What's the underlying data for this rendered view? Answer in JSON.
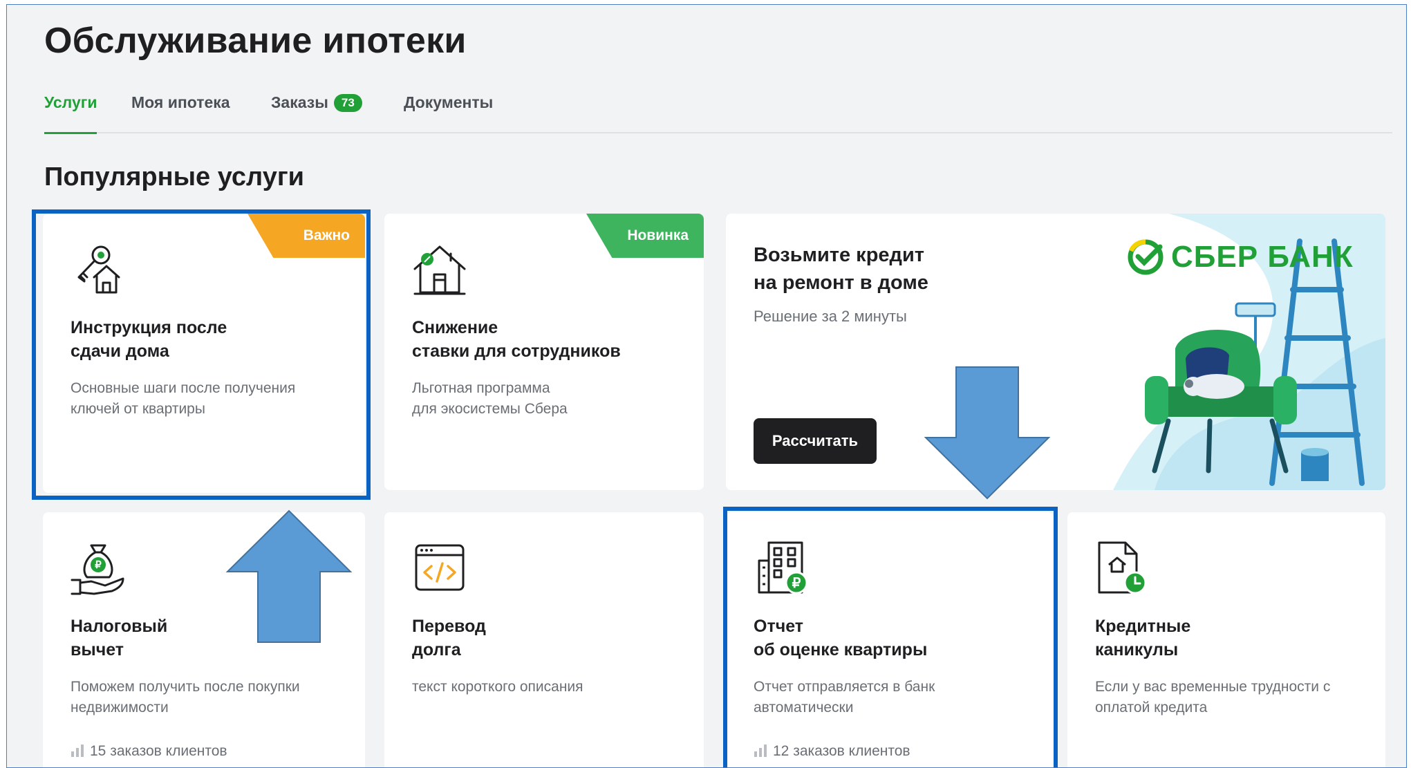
{
  "page": {
    "title": "Обслуживание ипотеки"
  },
  "tabs": [
    {
      "label": "Услуги",
      "active": true
    },
    {
      "label": "Моя ипотека"
    },
    {
      "label": "Заказы",
      "badge": "73"
    },
    {
      "label": "Документы"
    }
  ],
  "section": {
    "title": "Популярные услуги"
  },
  "cards": {
    "instruction": {
      "ribbon": "Важно",
      "title_line1": "Инструкция после",
      "title_line2": "сдачи дома",
      "desc_line1": "Основные шаги после получения",
      "desc_line2": "ключей от квартиры",
      "icon": "keys-house-icon"
    },
    "rate": {
      "ribbon": "Новинка",
      "title_line1": "Снижение",
      "title_line2": "ставки для сотрудников",
      "desc_line1": "Льготная программа",
      "desc_line2": "для экосистемы Сбера",
      "icon": "house-percent-icon"
    },
    "promo": {
      "title_line1": "Возьмите кредит",
      "title_line2": "на ремонт в доме",
      "subtitle": "Решение за 2 минуты",
      "button": "Рассчитать",
      "brand": "СБЕР БАНК"
    },
    "tax": {
      "title_line1": "Налоговый",
      "title_line2": "вычет",
      "desc_line1": "Поможем получить после покупки",
      "desc_line2": "недвижимости",
      "stats": "15 заказов клиентов",
      "icon": "money-bag-hand-icon"
    },
    "debt": {
      "title_line1": "Перевод",
      "title_line2": "долга",
      "desc_line1": "текст короткого описания",
      "icon": "code-window-icon"
    },
    "report": {
      "title_line1": "Отчет",
      "title_line2": "об оценке квартиры",
      "desc_line1": "Отчет отправляется в банк",
      "desc_line2": "автоматически",
      "stats": "12 заказов клиентов",
      "icon": "building-ruble-icon"
    },
    "holiday": {
      "title_line1": "Кредитные",
      "title_line2": "каникулы",
      "desc_line1": "Если у вас временные трудности с",
      "desc_line2": "оплатой кредита",
      "icon": "document-clock-icon"
    }
  },
  "colors": {
    "accent": "#21a038",
    "highlight": "#0a63c2",
    "arrow": "#5b9bd5",
    "important": "#f5a623"
  }
}
